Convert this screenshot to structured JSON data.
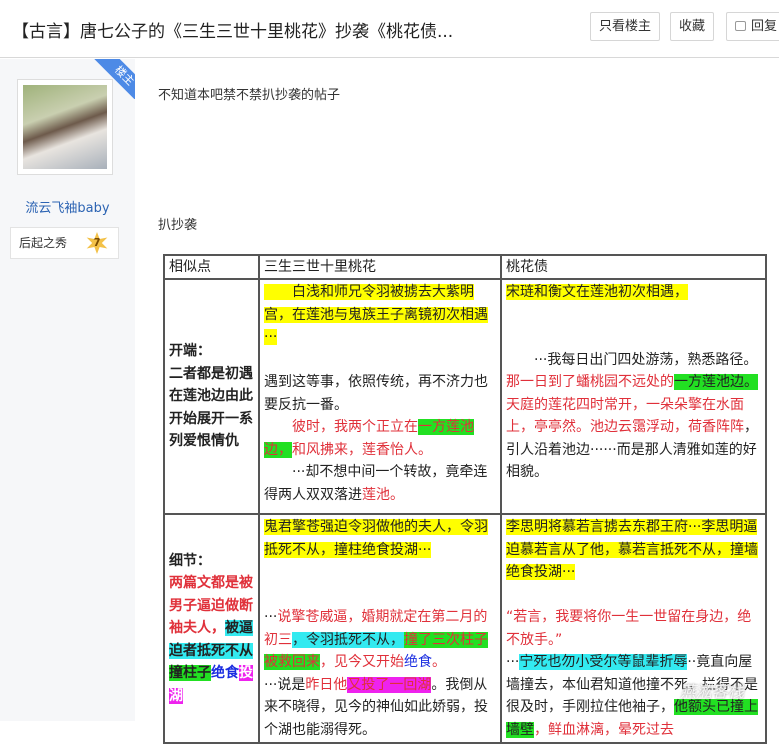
{
  "header": {
    "title": "【古言】唐七公子的《三生三世十里桃花》抄袭《桃花债...",
    "only_op": "只看楼主",
    "favorite": "收藏",
    "reply": "回复"
  },
  "user": {
    "badge": "楼主",
    "name": "流云飞袖baby",
    "level_title": "后起之秀",
    "level": "7"
  },
  "post": {
    "line1": "不知道本吧禁不禁扒抄袭的帖子",
    "line2": "扒抄袭"
  },
  "watermark": "燕淞客栈",
  "colors": {
    "yellow": "#ffff00",
    "green": "#22e022",
    "cyan": "#33eaf0",
    "magenta": "#ee22ee",
    "red": "#e0303a",
    "blue": "#1a2de0"
  },
  "table": {
    "headers": [
      "相似点",
      "三生三世十里桃花",
      "桃花债"
    ],
    "rows": [
      {
        "cells": [
          [
            [
              {
                "t": "开端："
              }
            ],
            [
              {
                "t": "二者都是初遇在莲池边由此开始展开一系列爱恨情仇"
              }
            ]
          ],
          [
            [
              {
                "t": "　　白浅和师兄令羽被掳去大紫明宫，在莲池与鬼族王子离镜初次相遇···",
                "bg": "yellow"
              }
            ],
            [],
            [
              {
                "t": "遇到这等事，依照传统，再不济力也要反抗一番。"
              }
            ],
            [
              {
                "t": "　　彼时，我两个正立在",
                "c": "red"
              },
              {
                "t": "一方莲池边，",
                "c": "red",
                "bg": "green"
              },
              {
                "t": "和风拂来，莲香怡人。",
                "c": "red"
              }
            ],
            [
              {
                "t": "　　···却不想中间一个转故，竟牵连得两人双双落进"
              },
              {
                "t": "莲池。",
                "c": "red"
              }
            ]
          ],
          [
            [
              {
                "t": "宋琏和衡文在莲池初次相遇，",
                "bg": "yellow"
              }
            ],
            [],
            [],
            [
              {
                "t": "　　···我每日出门四处游荡，熟悉路径。"
              },
              {
                "t": "那一日到了蟠桃园不远处的",
                "c": "red"
              },
              {
                "t": "一方莲池边。",
                "bg": "green"
              },
              {
                "t": "天庭的莲花四时常开，一朵朵擎在水面上，亭亭然。池边云霭浮动，荷香阵阵",
                "c": "red"
              },
              {
                "t": "，引人沿着池边······而是那人清雅如莲的好相貌。"
              }
            ]
          ]
        ]
      },
      {
        "cells": [
          [
            [
              {
                "t": "细节："
              }
            ],
            [
              {
                "t": "两篇文都是被男子逼迫做断袖夫人，",
                "c": "red"
              },
              {
                "t": "被逼迫者抵死不从",
                "bg": "cyan"
              },
              {
                "t": "撞柱子",
                "bg": "green"
              },
              {
                "t": "绝食",
                "c": "blue"
              },
              {
                "t": "投湖",
                "c": "white",
                "bg": "magenta"
              }
            ]
          ],
          [
            [
              {
                "t": "鬼君擎苍强迫令羽做他的夫人，令羽抵死不从，撞柱绝食投湖···",
                "bg": "yellow"
              }
            ],
            [],
            [],
            [
              {
                "t": "···"
              },
              {
                "t": "说擎苍威逼，婚期就定在第二月的初三",
                "c": "red"
              },
              {
                "t": "，令羽抵死不从，",
                "bg": "cyan"
              },
              {
                "t": "撞了三次柱子被救回来",
                "c": "red",
                "bg": "green"
              },
              {
                "t": "，见今又开始",
                "c": "red"
              },
              {
                "t": "绝食",
                "c": "blue"
              },
              {
                "t": "。",
                "c": "red"
              }
            ],
            [
              {
                "t": "···说是"
              },
              {
                "t": "昨日他",
                "c": "red"
              },
              {
                "t": "又投了一回湖",
                "c": "red",
                "bg": "magenta"
              },
              {
                "t": "。我倒从来不晓得，见今的神仙如此娇弱，投个湖也能溺得死。"
              }
            ]
          ],
          [
            [
              {
                "t": "李思明将慕若言掳去东郡王府···李思明逼迫慕若言从了他，慕若言抵死不从，撞墙绝食投湖···",
                "bg": "yellow"
              }
            ],
            [],
            [
              {
                "t": "“若言，我要将你一生一世留在身边，绝不放手。”",
                "c": "red"
              }
            ],
            [
              {
                "t": "···"
              },
              {
                "t": "宁死也勿小受尔等鼠辈折辱",
                "bg": "cyan"
              },
              {
                "t": "··竟直向屋墙撞去，本仙君知道他撞不死，拦得不是很及时，手刚拉住他袖子，"
              },
              {
                "t": "他额头已撞上墙壁",
                "bg": "green"
              },
              {
                "t": "，鲜血淋漓，晕死过去",
                "c": "red"
              }
            ]
          ]
        ]
      }
    ]
  }
}
